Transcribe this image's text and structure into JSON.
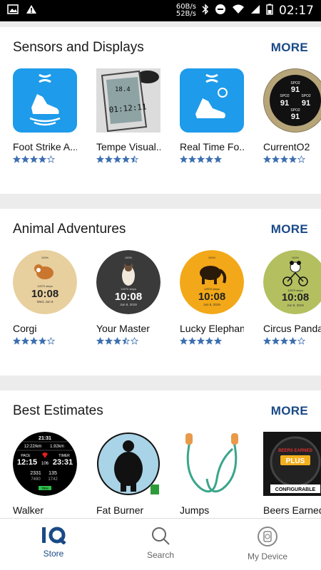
{
  "status_bar": {
    "net_up": "60B/s",
    "net_down": "52B/s",
    "time": "02:17"
  },
  "sections": [
    {
      "title": "Sensors and Displays",
      "more_label": "MORE",
      "items": [
        {
          "name": "Foot Strike A...",
          "rating": 4
        },
        {
          "name": "Tempe Visual...",
          "rating": 4.5
        },
        {
          "name": "Real Time Fo...",
          "rating": 5
        },
        {
          "name": "CurrentO2",
          "rating": 4
        }
      ]
    },
    {
      "title": "Animal Adventures",
      "more_label": "MORE",
      "items": [
        {
          "name": "Corgi",
          "rating": 4
        },
        {
          "name": "Your Master",
          "rating": 3.5
        },
        {
          "name": "Lucky Elephant",
          "rating": 5
        },
        {
          "name": "Circus Panda",
          "rating": 4
        }
      ]
    },
    {
      "title": "Best Estimates",
      "more_label": "MORE",
      "items": [
        {
          "name": "Walker"
        },
        {
          "name": "Fat Burner"
        },
        {
          "name": "Jumps"
        },
        {
          "name": "Beers Earned..."
        }
      ]
    }
  ],
  "watch_faces": {
    "battery": "100%",
    "steps": "12570 steps",
    "time": "10:08",
    "date_corgi": "Wed, Jun 8",
    "date_other": "Jun 8, 2019"
  },
  "device_thumb": {
    "top": "18.4",
    "bottom": "01:12:11"
  },
  "spo2": {
    "label": "SPO2",
    "value": "91"
  },
  "walker": {
    "time_top": "21:31",
    "pace": "12:22/km",
    "distance": "1.92km",
    "pace_label": "PACE",
    "timer_label": "TIMER",
    "pace_val": "12:15",
    "hr": "106",
    "timer_val": "23:31",
    "a": "2331",
    "b": "135",
    "c": "7490",
    "d": "1742",
    "pct": "75%"
  },
  "beers": {
    "line1": "BEERS EARNED",
    "line2": "PLUS",
    "banner": "CONFIGURABLE"
  },
  "bottom_nav": [
    {
      "label": "Store"
    },
    {
      "label": "Search"
    },
    {
      "label": "My Device"
    }
  ],
  "colors": {
    "accent": "#1a4a86",
    "star": "#3d6fb0",
    "ua_blue": "#1e9bea"
  }
}
